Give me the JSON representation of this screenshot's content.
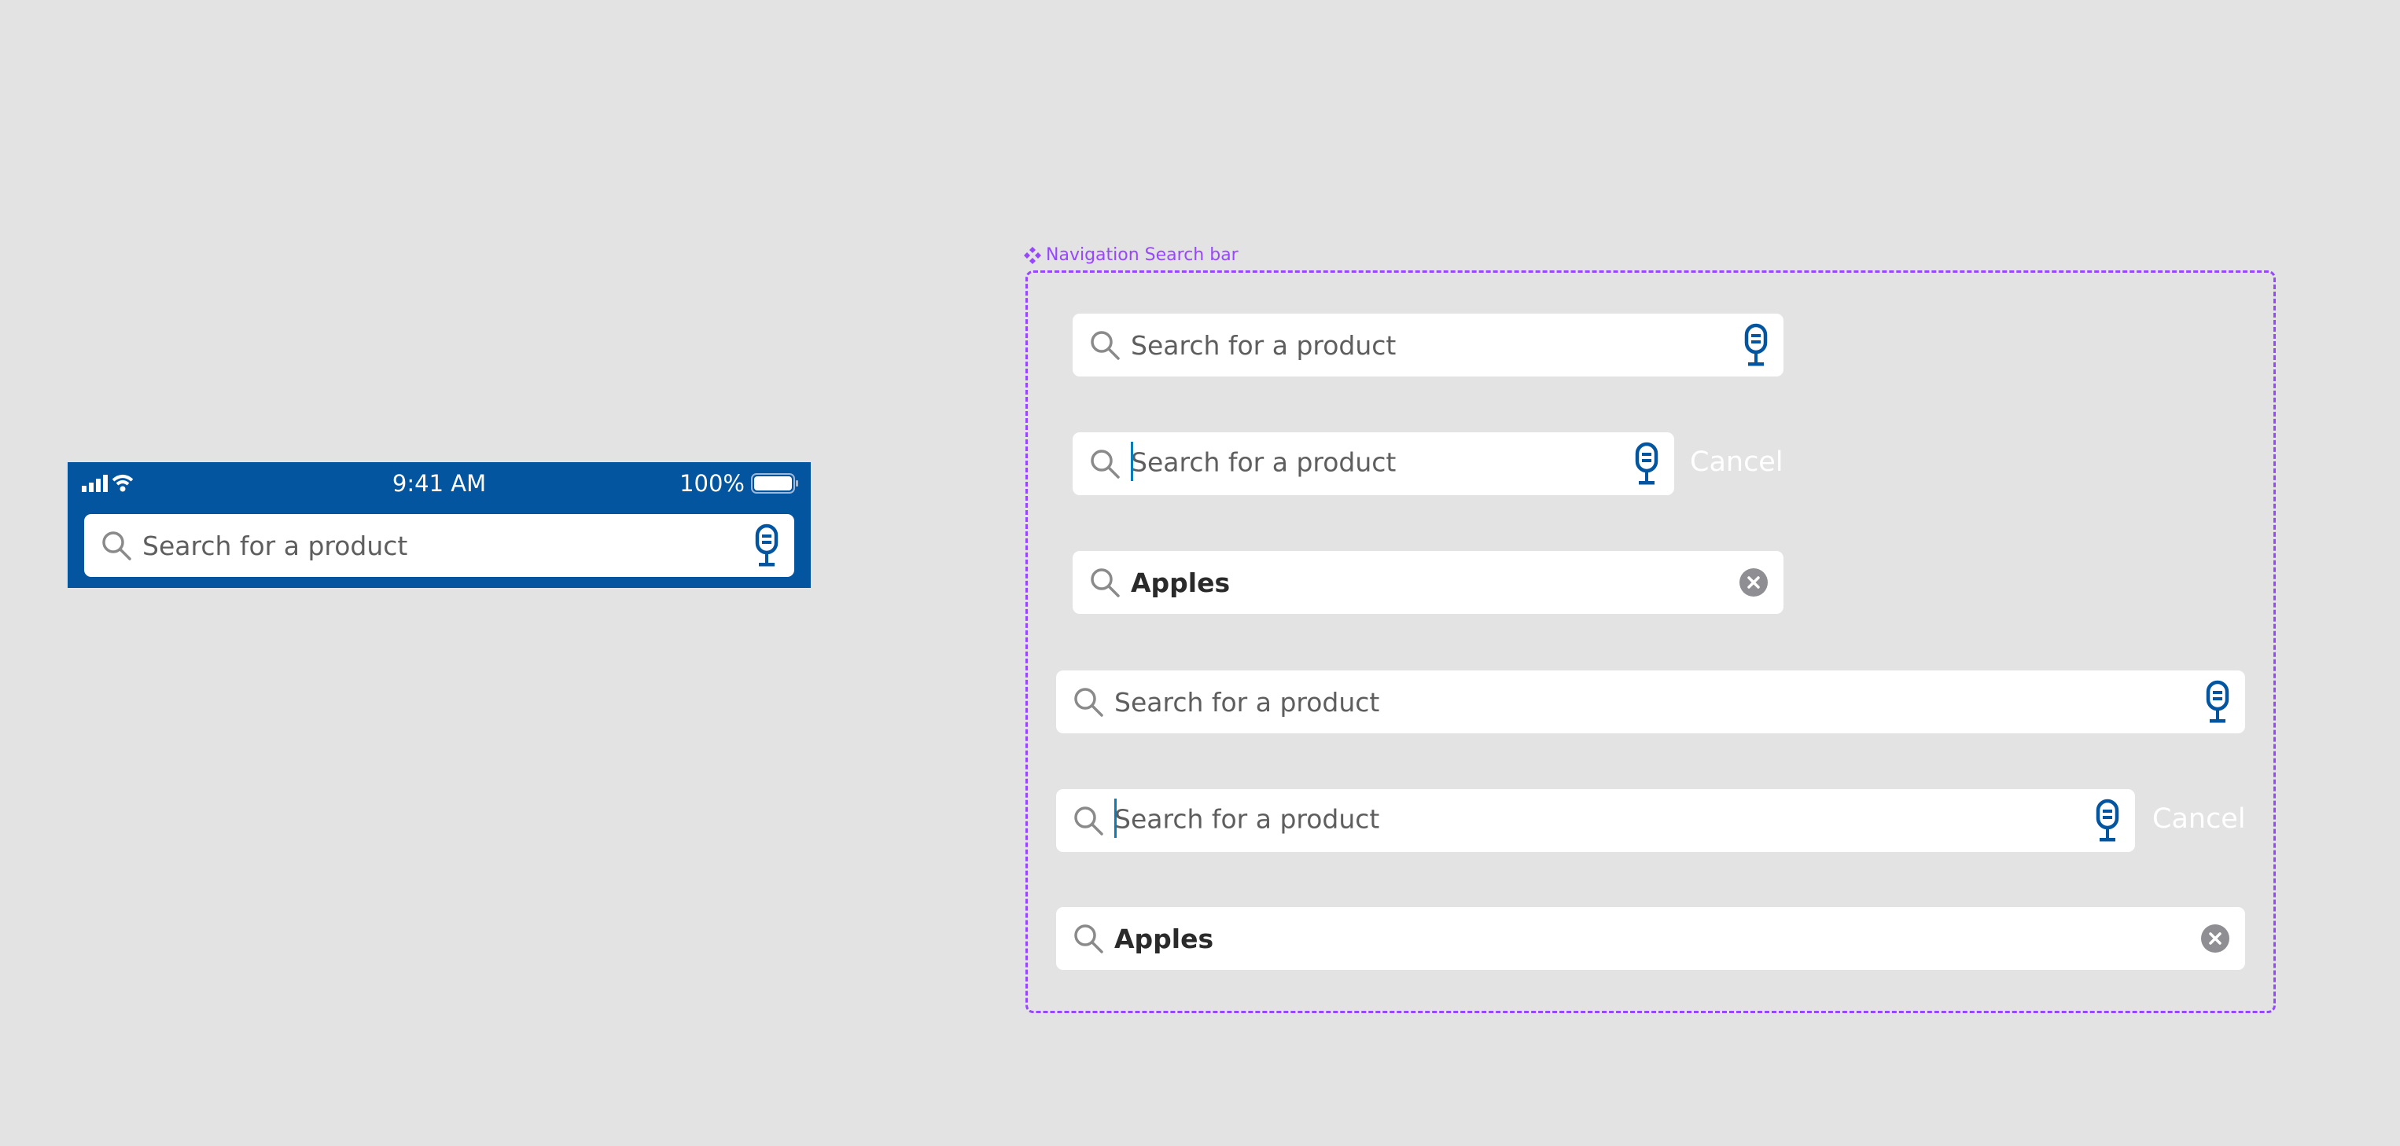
{
  "status_bar": {
    "time": "9:41 AM",
    "battery": "100%",
    "icons": [
      "signal-icon",
      "wifi-icon",
      "battery-icon"
    ]
  },
  "phone_search": {
    "placeholder": "Search for a product"
  },
  "component": {
    "label": "Navigation Search bar",
    "icon": "component-icon"
  },
  "variants": [
    {
      "placeholder": "Search for a product"
    },
    {
      "placeholder": "Search for a product",
      "cancel": "Cancel"
    },
    {
      "value": "Apples"
    },
    {
      "placeholder": "Search for a product"
    },
    {
      "placeholder": "Search for a product",
      "cancel": "Cancel"
    },
    {
      "value": "Apples"
    }
  ],
  "colors": {
    "brand_blue": "#0355a0",
    "canvas": "#e3e3e3",
    "frame": "#9747ff",
    "caret": "#0a7cb8"
  }
}
